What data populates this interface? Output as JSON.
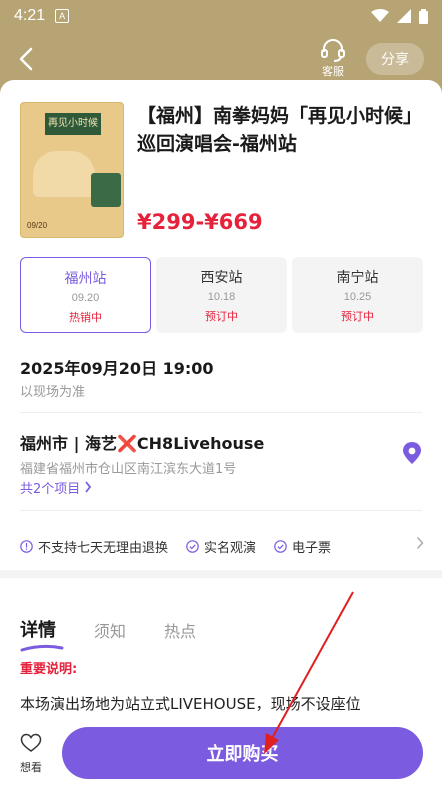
{
  "status_bar": {
    "time": "4:21",
    "badge": "A"
  },
  "header": {
    "service_label": "客服",
    "share_label": "分享"
  },
  "event": {
    "title": "【福州】南拳妈妈「再见小时候」巡回演唱会-福州站",
    "price": "¥299-¥669",
    "poster": {
      "title_text": "再见小时候",
      "date_text": "09/20"
    }
  },
  "stations": [
    {
      "name": "福州站",
      "date": "09.20",
      "status": "热销中",
      "active": true
    },
    {
      "name": "西安站",
      "date": "10.18",
      "status": "预订中",
      "active": false
    },
    {
      "name": "南宁站",
      "date": "10.25",
      "status": "预订中",
      "active": false
    }
  ],
  "schedule": {
    "datetime": "2025年09月20日 19:00",
    "note": "以现场为准"
  },
  "venue": {
    "city": "福州市 | 海艺",
    "x_mark": "❌",
    "name_suffix": "CH8Livehouse",
    "address": "福建省福州市仓山区南江滨东大道1号",
    "projects_link": "共2个项目"
  },
  "policies": [
    "不支持七天无理由退换",
    "实名观演",
    "电子票"
  ],
  "tabs": [
    {
      "label": "详情",
      "active": true
    },
    {
      "label": "须知",
      "active": false
    },
    {
      "label": "热点",
      "active": false
    }
  ],
  "detail": {
    "important_label": "重要说明:",
    "description": "本场演出场地为站立式LIVEHOUSE，现场不设座位"
  },
  "bottom": {
    "want_label": "想看",
    "buy_label": "立即购买"
  },
  "colors": {
    "header_bg": "#b7a474",
    "accent": "#7b5ce0",
    "price": "#e6213b"
  }
}
